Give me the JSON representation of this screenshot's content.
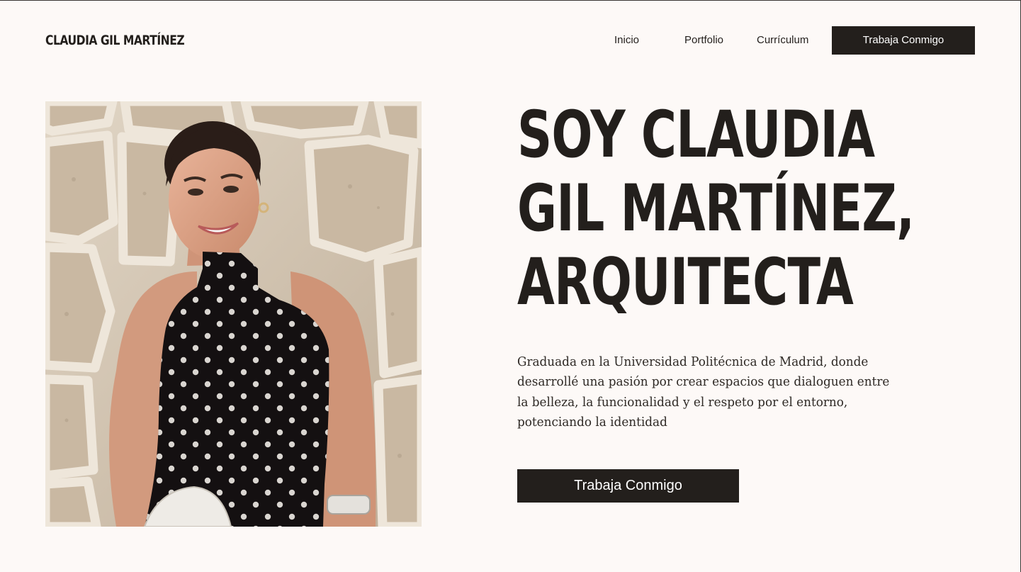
{
  "header": {
    "brand": "CLAUDIA GIL MARTÍNEZ",
    "nav": {
      "inicio": "Inicio",
      "portfolio": "Portfolio",
      "curriculum": "Currículum"
    },
    "cta_label": "Trabaja Conmigo"
  },
  "hero": {
    "title_lines": [
      "SOY CLAUDIA",
      "GIL MARTÍNEZ,",
      "ARQUITECTA"
    ],
    "description_lines": [
      "Graduada en la Universidad Politécnica de Madrid, donde",
      "desarrollé una pasión por crear espacios que dialoguen entre",
      "la belleza, la funcionalidad y el respeto por el entorno,",
      "potenciando la identidad"
    ],
    "cta_label": "Trabaja Conmigo"
  },
  "colors": {
    "background": "#fdf9f7",
    "text": "#231f1c",
    "button_bg": "#231f1c",
    "button_text": "#ffffff"
  }
}
